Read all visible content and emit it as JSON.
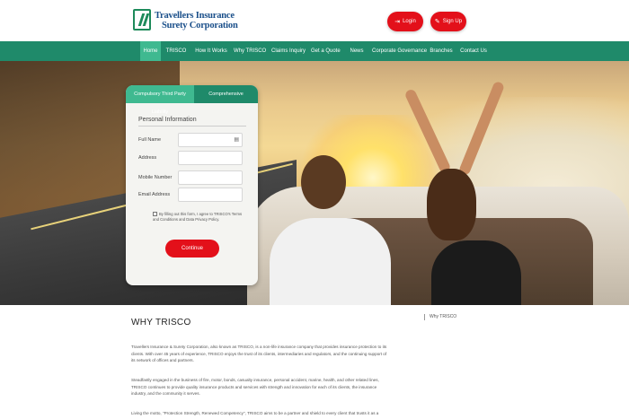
{
  "header": {
    "logo_line1": "Travellers Insurance",
    "logo_line2": "Surety Corporation",
    "login_label": "Login",
    "signup_label": "Sign Up",
    "login_icon": "login-icon",
    "signup_icon": "edit-icon"
  },
  "nav": {
    "items": [
      {
        "label": "Home",
        "active": true
      },
      {
        "label": "TRISCO",
        "active": false
      },
      {
        "label": "How It Works",
        "active": false
      },
      {
        "label": "Why TRISCO",
        "active": false
      },
      {
        "label": "Claims Inquiry",
        "active": false
      },
      {
        "label": "Get a Quote",
        "active": false
      },
      {
        "label": "News",
        "active": false
      },
      {
        "label": "Corporate Governance",
        "active": false
      },
      {
        "label": "Branches",
        "active": false
      },
      {
        "label": "Contact Us",
        "active": false
      }
    ]
  },
  "form": {
    "tab1": "Compulsory Third Party Liability",
    "tab2": "Comprehensive",
    "title": "Personal Information",
    "fields": [
      {
        "label": "Full Name",
        "value": ""
      },
      {
        "label": "Address",
        "value": ""
      },
      {
        "label": "Mobile Number",
        "value": ""
      },
      {
        "label": "Email Address",
        "value": ""
      }
    ],
    "consent": "By filling out this form, I agree to TRISCO's Terms and Conditions and Data Privacy Policy.",
    "continue_label": "Continue"
  },
  "content": {
    "section_title": "WHY TRISCO",
    "side_link": "Why TRISCO",
    "paragraphs": [
      "Travellers Insurance & Surety Corporation, also known as TRISCO, is a non-life insurance company that provides insurance protection to its clients. With over 45 years of experience, TRISCO enjoys the trust of its clients, intermediaries and regulators, and the continuing support of its network of offices and partners.",
      "Steadfastly engaged in the business of fire, motor, bonds, casualty insurance, personal accident, marine, health, and other related lines, TRISCO continues to provide quality insurance products and services with strength and innovation for each of its clients, the insurance industry, and the community it serves.",
      "Living the motto, \"Protection Strength, Renewed Competency\", TRISCO aims to be a partner and shield to every client that trusts it as a"
    ]
  }
}
